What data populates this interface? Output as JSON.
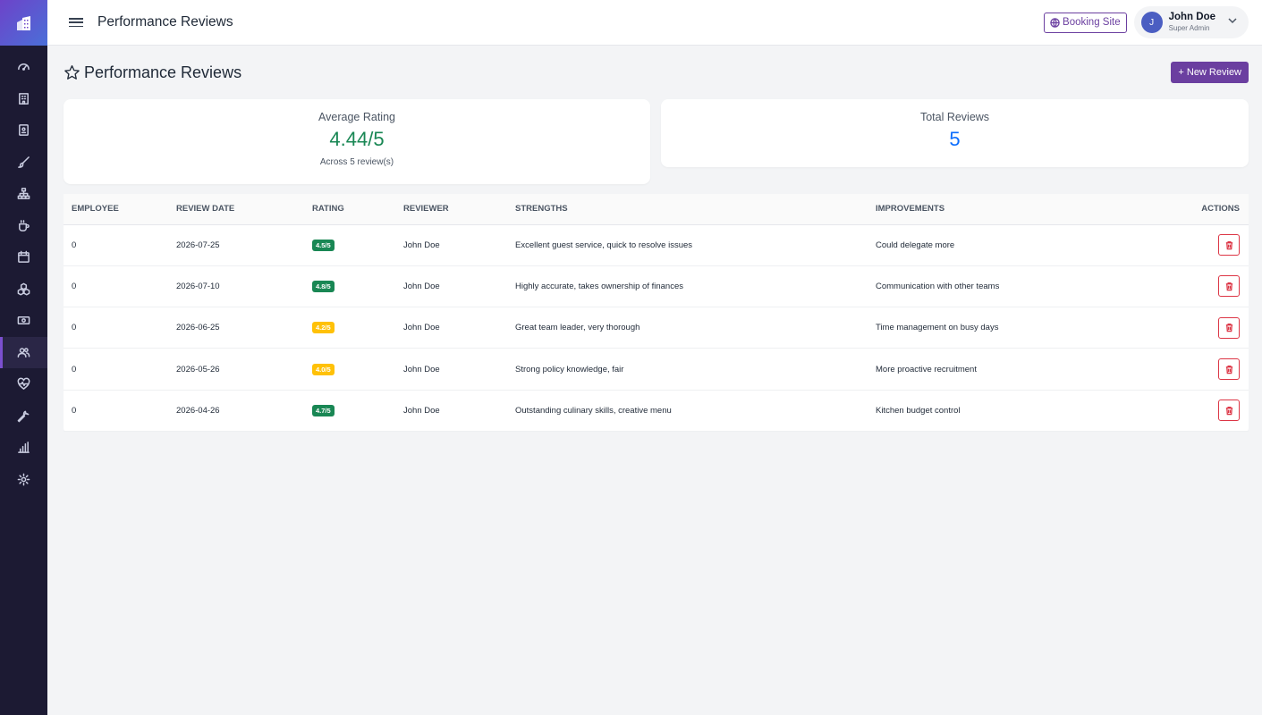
{
  "header": {
    "title": "Performance Reviews",
    "booking_label": "Booking Site",
    "user": {
      "initial": "J",
      "name": "John Doe",
      "role": "Super Admin"
    }
  },
  "sidebar": {
    "items": [
      {
        "icon": "dashboard-icon"
      },
      {
        "icon": "building-icon"
      },
      {
        "icon": "reservation-icon"
      },
      {
        "icon": "brush-icon"
      },
      {
        "icon": "org-chart-icon"
      },
      {
        "icon": "coffee-icon"
      },
      {
        "icon": "calendar-icon"
      },
      {
        "icon": "boxes-icon"
      },
      {
        "icon": "cash-icon"
      },
      {
        "icon": "people-icon",
        "active": true
      },
      {
        "icon": "heart-pulse-icon"
      },
      {
        "icon": "wrench-icon"
      },
      {
        "icon": "bar-chart-icon"
      },
      {
        "icon": "gear-icon"
      }
    ]
  },
  "page": {
    "title": "Performance Reviews",
    "new_button": "+ New Review"
  },
  "cards": {
    "average": {
      "label": "Average Rating",
      "value": "4.44/5",
      "sub": "Across 5 review(s)"
    },
    "total": {
      "label": "Total Reviews",
      "value": "5"
    }
  },
  "table": {
    "headers": [
      "Employee",
      "Review Date",
      "Rating",
      "Reviewer",
      "Strengths",
      "Improvements",
      "Actions"
    ],
    "rows": [
      {
        "employee": "0",
        "date": "2026-07-25",
        "rating": "4.5/5",
        "rating_color": "green",
        "reviewer": "John Doe",
        "strengths": "Excellent guest service, quick to resolve issues",
        "improvements": "Could delegate more"
      },
      {
        "employee": "0",
        "date": "2026-07-10",
        "rating": "4.8/5",
        "rating_color": "green",
        "reviewer": "John Doe",
        "strengths": "Highly accurate, takes ownership of finances",
        "improvements": "Communication with other teams"
      },
      {
        "employee": "0",
        "date": "2026-06-25",
        "rating": "4.2/5",
        "rating_color": "yellow",
        "reviewer": "John Doe",
        "strengths": "Great team leader, very thorough",
        "improvements": "Time management on busy days"
      },
      {
        "employee": "0",
        "date": "2026-05-26",
        "rating": "4.0/5",
        "rating_color": "yellow",
        "reviewer": "John Doe",
        "strengths": "Strong policy knowledge, fair",
        "improvements": "More proactive recruitment"
      },
      {
        "employee": "0",
        "date": "2026-04-26",
        "rating": "4.7/5",
        "rating_color": "green",
        "reviewer": "John Doe",
        "strengths": "Outstanding culinary skills, creative menu",
        "improvements": "Kitchen budget control"
      }
    ]
  },
  "colors": {
    "accent": "#6b3fa0",
    "sidebar": "#1c1a33",
    "success": "#198754",
    "warning": "#ffc107",
    "primary": "#0d6efd",
    "danger": "#dc3545"
  }
}
